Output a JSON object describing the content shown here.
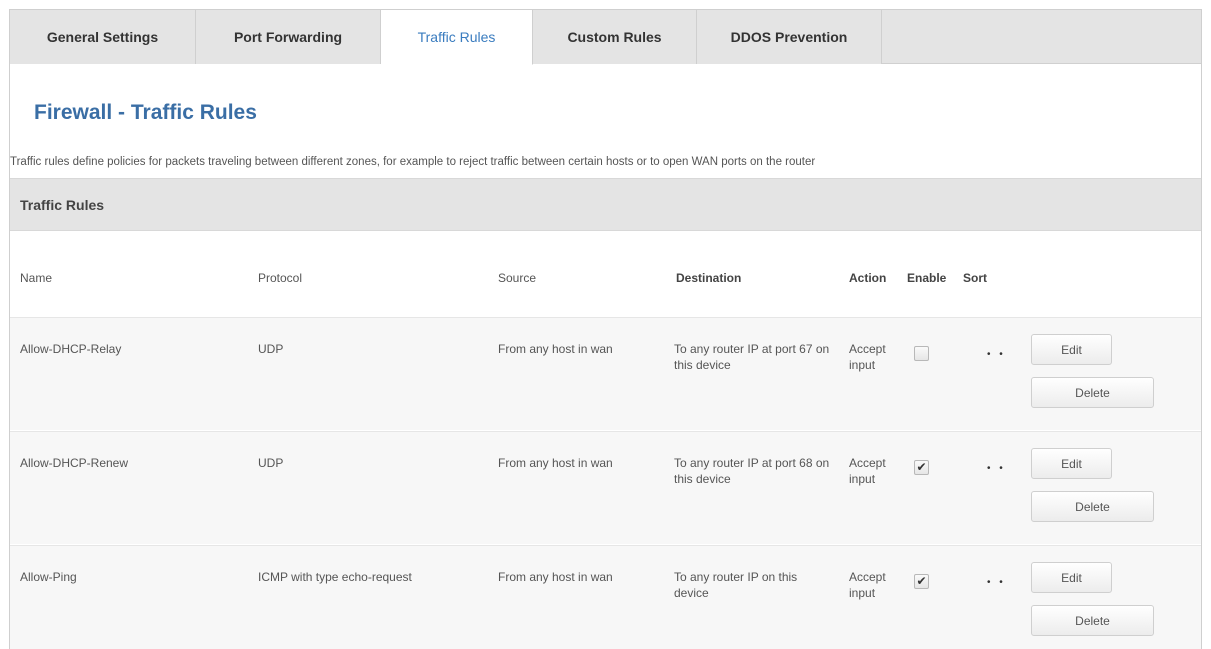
{
  "tabs": [
    {
      "label": "General Settings"
    },
    {
      "label": "Port Forwarding"
    },
    {
      "label": "Traffic Rules"
    },
    {
      "label": "Custom Rules"
    },
    {
      "label": "DDOS Prevention"
    }
  ],
  "active_tab": "Traffic Rules",
  "page": {
    "title": "Firewall - Traffic Rules",
    "description": "Traffic rules define policies for packets traveling between different zones, for example to reject traffic between certain hosts or to open WAN ports on the router",
    "section_title": "Traffic Rules"
  },
  "table": {
    "columns": [
      "Name",
      "Protocol",
      "Source",
      "Destination",
      "Action",
      "Enable",
      "Sort"
    ],
    "rows": [
      {
        "name": "Allow-DHCP-Relay",
        "protocol": "UDP",
        "source": "From any host in wan",
        "destination": "To any router IP at port 67 on this device",
        "action": "Accept input",
        "enabled": false,
        "enable_glyph": "",
        "sort": "• •",
        "edit_label": "Edit",
        "delete_label": "Delete"
      },
      {
        "name": "Allow-DHCP-Renew",
        "protocol": "UDP",
        "source": "From any host in wan",
        "destination": "To any router IP at port 68 on this device",
        "action": "Accept input",
        "enabled": true,
        "enable_glyph": "✔",
        "sort": "• •",
        "edit_label": "Edit",
        "delete_label": "Delete"
      },
      {
        "name": "Allow-Ping",
        "protocol": "ICMP with type echo-request",
        "source": "From any host in wan",
        "destination": "To any router IP on this device",
        "action": "Accept input",
        "enabled": true,
        "enable_glyph": "✔",
        "sort": "• •",
        "edit_label": "Edit",
        "delete_label": "Delete"
      }
    ]
  },
  "colors": {
    "title": "#3a6ea5",
    "active_tab": "#3a7cbf",
    "tab_bg": "#e4e4e4",
    "row_bg": "#f7f7f7"
  }
}
